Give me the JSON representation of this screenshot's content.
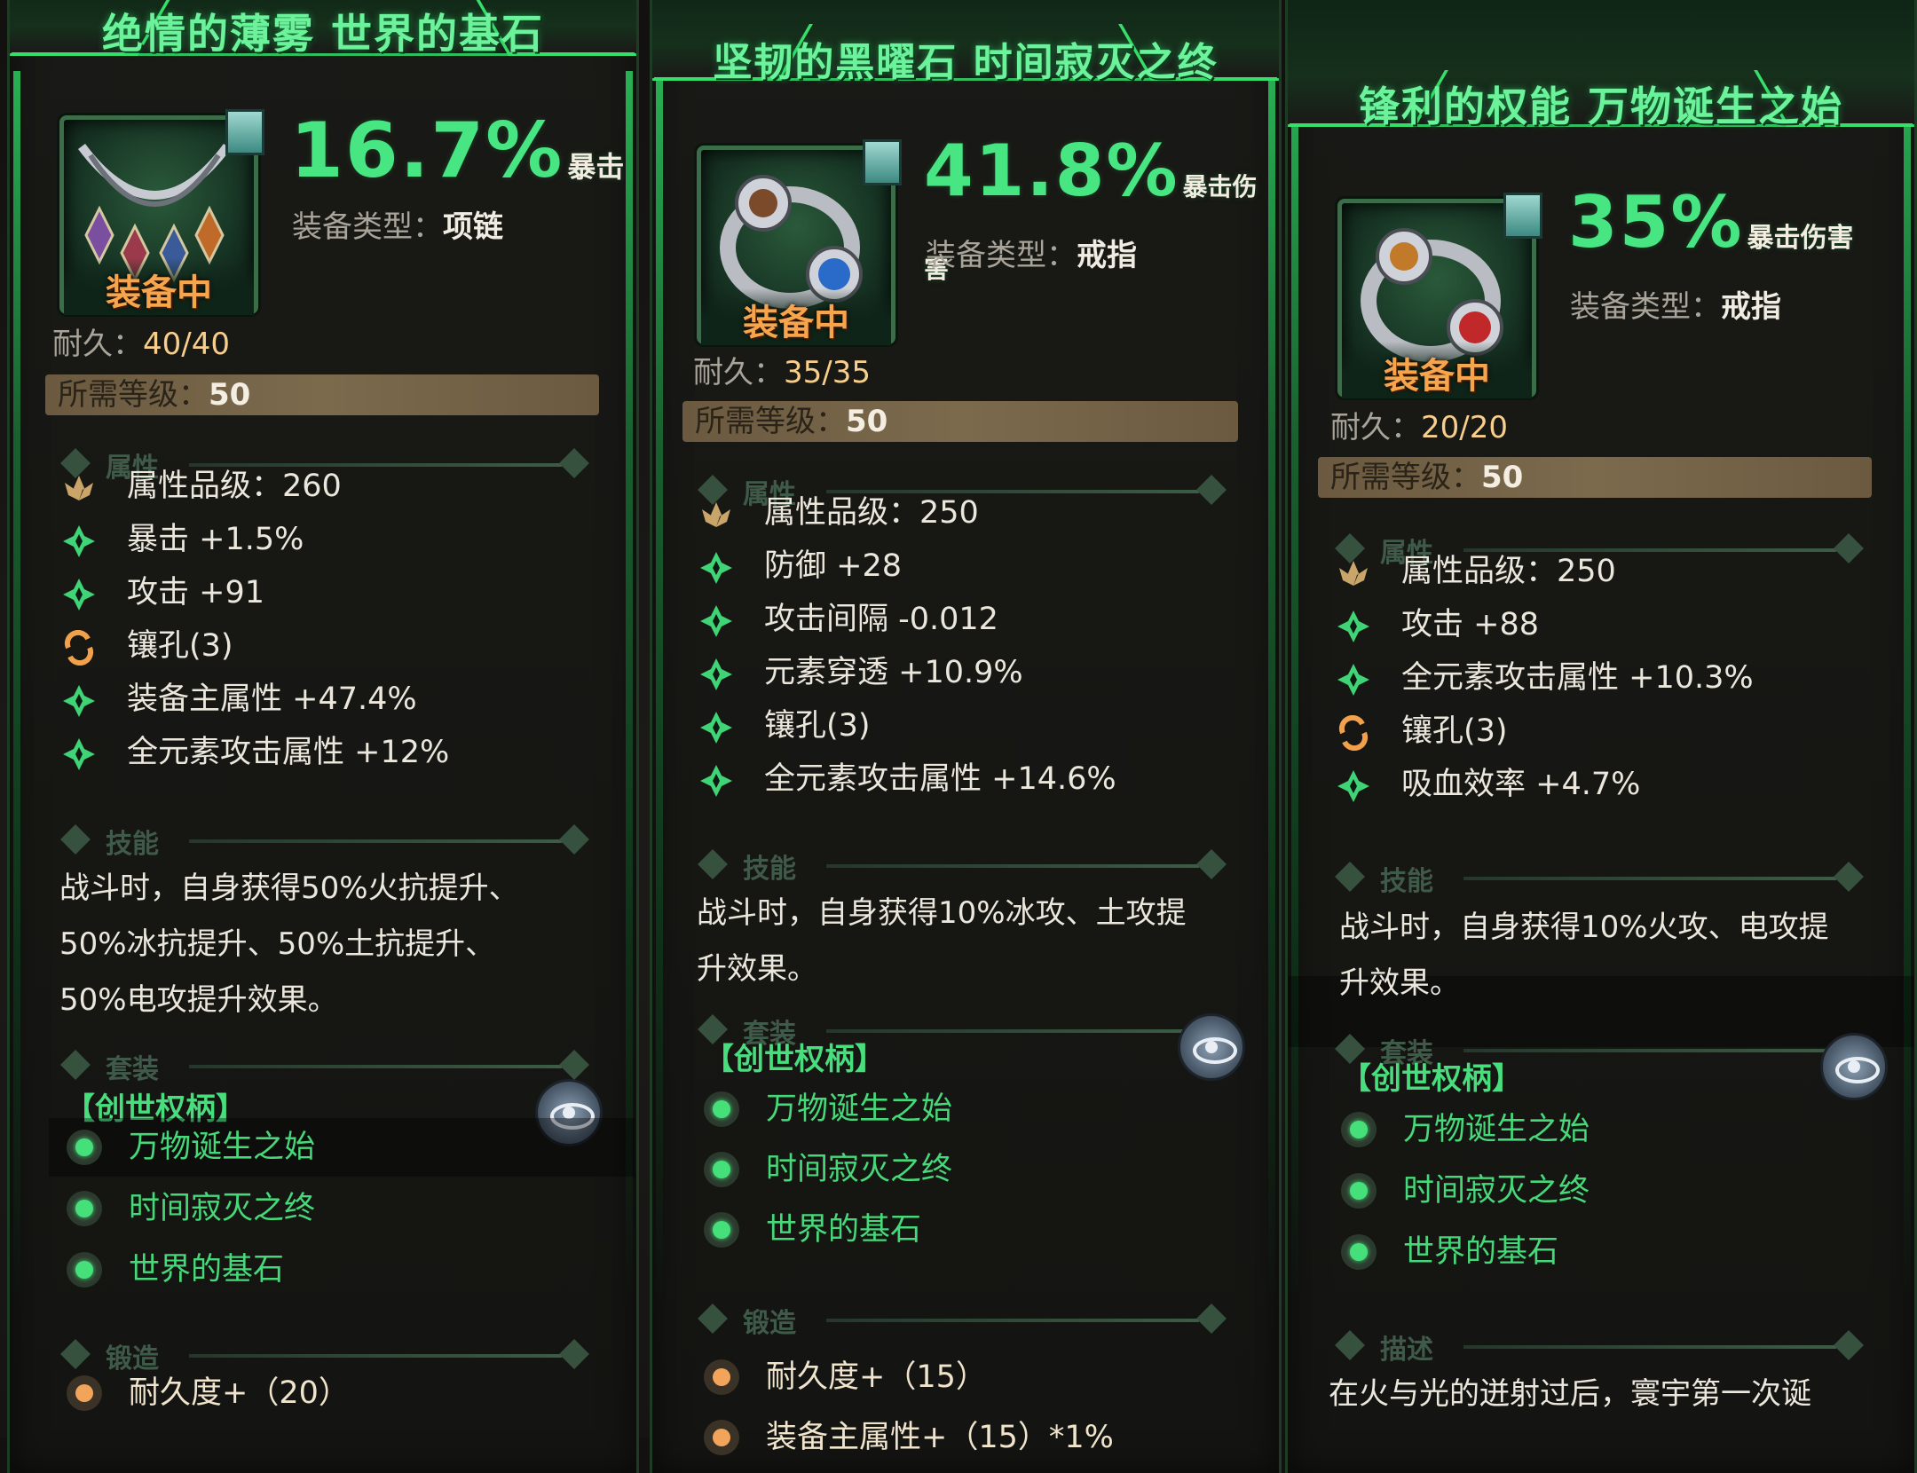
{
  "panels": [
    {
      "title": "绝情的薄雾 世界的基石",
      "equipped_label": "装备中",
      "main_value": "16.7%",
      "main_label": "暴击",
      "type_label": "装备类型：",
      "type_value": "项链",
      "durability_label": "耐久：",
      "durability_value": "40/40",
      "req_label": "所需等级：",
      "req_value": "50",
      "attr_section": "属性",
      "attrs": [
        "属性品级：260",
        "暴击 +1.5%",
        "攻击 +91",
        "镶孔(3)",
        "装备主属性 +47.4%",
        "全元素攻击属性 +12%"
      ],
      "attr_icons": [
        "lotus-icon",
        "star-icon",
        "star-icon",
        "socket-icon",
        "star-icon",
        "star-icon"
      ],
      "skill_section": "技能",
      "skill_lines": [
        "战斗时，自身获得50%火抗提升、",
        "50%冰抗提升、50%土抗提升、",
        "50%电攻提升效果。"
      ],
      "set_section": "套装",
      "set_name": "【创世权柄】",
      "set_items": [
        "万物诞生之始",
        "时间寂灭之终",
        "世界的基石"
      ],
      "forge_section": "锻造",
      "forge_items": [
        "耐久度+（20）"
      ]
    },
    {
      "title": "坚韧的黑曜石 时间寂灭之终",
      "equipped_label": "装备中",
      "main_value": "41.8%",
      "main_label": "暴击伤害",
      "type_label": "装备类型：",
      "type_value": "戒指",
      "durability_label": "耐久：",
      "durability_value": "35/35",
      "req_label": "所需等级：",
      "req_value": "50",
      "attr_section": "属性",
      "attrs": [
        "属性品级：250",
        "防御 +28",
        "攻击间隔 -0.012",
        "元素穿透 +10.9%",
        "镶孔(3)",
        "全元素攻击属性 +14.6%"
      ],
      "attr_icons": [
        "lotus-icon",
        "star-icon",
        "star-icon",
        "star-icon",
        "star-icon",
        "star-icon"
      ],
      "skill_section": "技能",
      "skill_lines": [
        "战斗时，自身获得10%冰攻、土攻提",
        "升效果。"
      ],
      "set_section": "套装",
      "set_name": "【创世权柄】",
      "set_items": [
        "万物诞生之始",
        "时间寂灭之终",
        "世界的基石"
      ],
      "forge_section": "锻造",
      "forge_items": [
        "耐久度+（15）",
        "装备主属性+（15）*1%"
      ]
    },
    {
      "title": "锋利的权能 万物诞生之始",
      "equipped_label": "装备中",
      "main_value": "35%",
      "main_label": "暴击伤害",
      "type_label": "装备类型：",
      "type_value": "戒指",
      "durability_label": "耐久：",
      "durability_value": "20/20",
      "req_label": "所需等级：",
      "req_value": "50",
      "attr_section": "属性",
      "attrs": [
        "属性品级：250",
        "攻击 +88",
        "全元素攻击属性 +10.3%",
        "镶孔(3)",
        "吸血效率 +4.7%"
      ],
      "attr_icons": [
        "lotus-icon",
        "star-icon",
        "star-icon",
        "socket-icon",
        "star-icon"
      ],
      "skill_section": "技能",
      "skill_lines": [
        "战斗时，自身获得10%火攻、电攻提",
        "升效果。"
      ],
      "set_section": "套装",
      "set_name": "【创世权柄】",
      "set_items": [
        "万物诞生之始",
        "时间寂灭之终",
        "世界的基石"
      ],
      "desc_section": "描述",
      "desc_line": "在火与光的迸射过后，寰宇第一次诞"
    }
  ],
  "colors": {
    "title_green": "#6cf29a",
    "value_green": "#47e683",
    "equipped_orange": "#f7a54d",
    "set_green": "#46d879"
  }
}
